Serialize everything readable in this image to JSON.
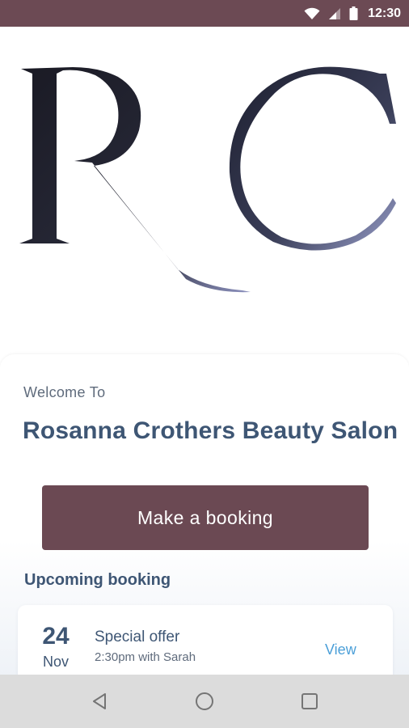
{
  "status_bar": {
    "time": "12:30",
    "icons": [
      "wifi-icon",
      "cell-signal-icon",
      "battery-icon"
    ],
    "background": "#6c4a54"
  },
  "logo": {
    "letters": "RC",
    "colors": {
      "dark": "#1a1a24",
      "highlight": "#8e93c0"
    }
  },
  "welcome": {
    "greeting": "Welcome To",
    "salon_name": "Rosanna Crothers Beauty Salon"
  },
  "actions": {
    "book_label": "Make a booking",
    "button_color": "#6b4953"
  },
  "upcoming": {
    "heading": "Upcoming booking",
    "booking": {
      "day": "24",
      "month": "Nov",
      "title": "Special offer",
      "detail": "2:30pm with Sarah",
      "view_label": "View"
    }
  },
  "nav_bar": {
    "buttons": [
      "back-icon",
      "home-icon",
      "recents-icon"
    ]
  },
  "colors": {
    "text_primary": "#3e5674",
    "text_secondary": "#5f6b7c",
    "link": "#4b9fd8"
  }
}
